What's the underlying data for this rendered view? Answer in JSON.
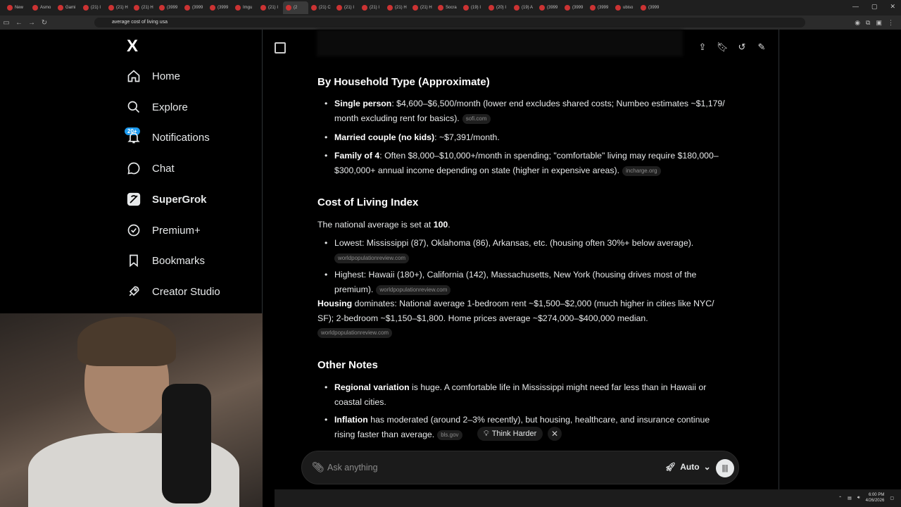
{
  "browser": {
    "tabs": [
      "New",
      "Asmo",
      "Gami",
      "(21) I",
      "(21) H",
      "(21) H",
      "(3999",
      "(3999",
      "(3999",
      "Imgu",
      "(21) I",
      "(2",
      "(21) C",
      "(21) I",
      "(21) I",
      "(21) H",
      "(21) H",
      "Socra",
      "(19) I",
      "(20) I",
      "(19) A",
      "(3999",
      "(3999",
      "(3999",
      "ubiso",
      "(3999"
    ],
    "active_tab_index": 11,
    "url": "average cost of living usa",
    "time": "6:00 PM",
    "date": "4/26/2026"
  },
  "sidebar": {
    "logo": "X",
    "badge": "20+",
    "items": [
      {
        "label": "Home",
        "icon": "home-icon"
      },
      {
        "label": "Explore",
        "icon": "search-icon"
      },
      {
        "label": "Notifications",
        "icon": "bell-icon"
      },
      {
        "label": "Chat",
        "icon": "chat-icon"
      },
      {
        "label": "SuperGrok",
        "icon": "grok-icon"
      },
      {
        "label": "Premium+",
        "icon": "verified-icon"
      },
      {
        "label": "Bookmarks",
        "icon": "bookmark-icon"
      },
      {
        "label": "Creator Studio",
        "icon": "rocket-icon"
      }
    ]
  },
  "content": {
    "section1_title": "By Household Type (Approximate)",
    "b1_bold": "Single person",
    "b1_text": ": $4,600–$6,500/month (lower end excludes shared costs; Numbeo estimates ~$1,179/ month excluding rent for basics).",
    "b1_chip": "sofi.com",
    "b2_bold": "Married couple (no kids)",
    "b2_text": ": ~$7,391/month.",
    "b3_bold": "Family of 4",
    "b3_text": ": Often $8,000–$10,000+/month in spending; \"comfortable\" living may require $180,000–$300,000+ annual income depending on state (higher in expensive areas).",
    "b3_chip": "incharge.org",
    "section2_title": "Cost of Living Index",
    "index_text_pre": "The national average is set at ",
    "index_value": "100",
    "index_text_post": ".",
    "b4_text": "Lowest: Mississippi (87), Oklahoma (86), Arkansas, etc. (housing often 30%+ below average).",
    "b4_chip": "worldpopulationreview.com",
    "b5_text": "Highest: Hawaii (180+), California (142), Massachusetts, New York (housing drives most of the premium).",
    "b5_chip": "worldpopulationreview.com",
    "housing_bold": "Housing",
    "housing_text": " dominates: National average 1-bedroom rent ~$1,500–$2,000 (much higher in cities like NYC/ SF); 2-bedroom ~$1,150–$1,800. Home prices average ~$274,000–$400,000 median.",
    "housing_chip": "worldpopulationreview.com",
    "section3_title": "Other Notes",
    "b6_bold": "Regional variation",
    "b6_text": " is huge. A comfortable life in Mississippi might need far less than in Hawaii or coastal cities.",
    "b7_bold": "Inflation",
    "b7_text": " has moderated (around 2–3% recently), but housing, healthcare, and insurance continue rising faster than average.",
    "b7_chip": "bls.gov"
  },
  "composer": {
    "think_label": "Think Harder",
    "placeholder": "Ask anything",
    "mode_label": "Auto"
  }
}
